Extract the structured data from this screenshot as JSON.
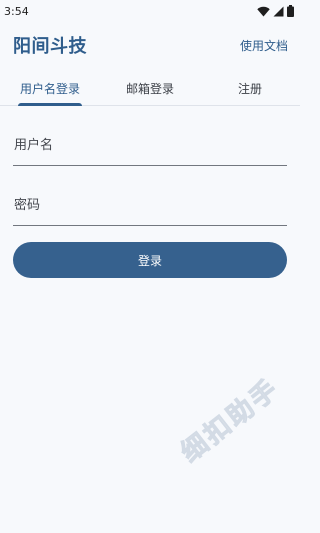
{
  "status_bar": {
    "time": "3:54"
  },
  "app_bar": {
    "title": "阳间斗技",
    "help_link": "使用文档"
  },
  "tabs": [
    {
      "label": "用户名登录",
      "active": true
    },
    {
      "label": "邮箱登录",
      "active": false
    },
    {
      "label": "注册",
      "active": false
    }
  ],
  "form": {
    "username": {
      "placeholder": "用户名",
      "value": ""
    },
    "password": {
      "placeholder": "密码",
      "value": ""
    },
    "login_label": "登录"
  },
  "watermark": "细扣助手",
  "colors": {
    "primary": "#36618e",
    "title": "#2f5d8c",
    "background": "#f7f9fc"
  },
  "icons": [
    "wifi-icon",
    "cellular-signal-icon",
    "battery-icon"
  ]
}
